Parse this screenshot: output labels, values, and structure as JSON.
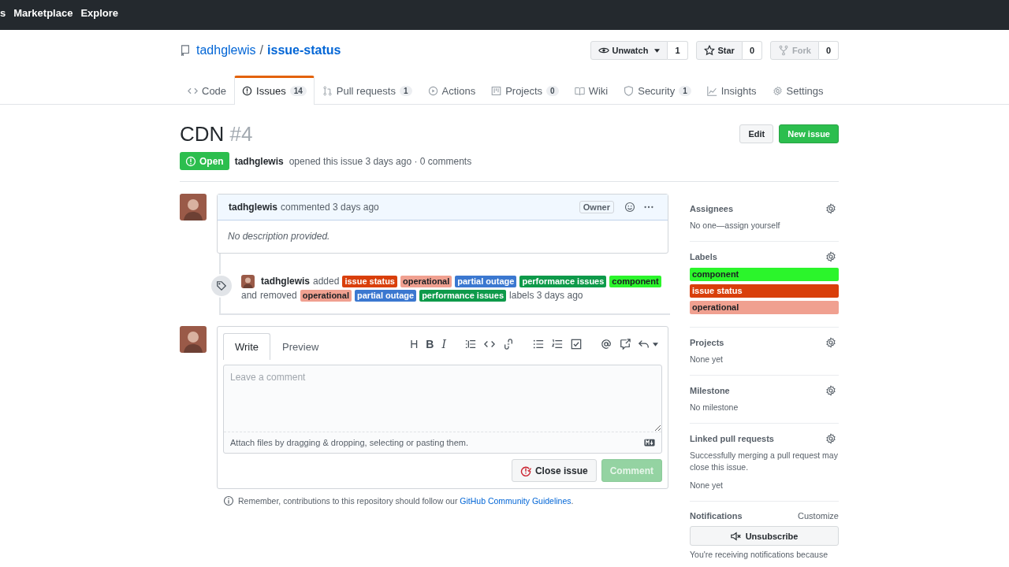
{
  "top_nav": [
    {
      "label": "s"
    },
    {
      "label": "Marketplace"
    },
    {
      "label": "Explore"
    }
  ],
  "repo": {
    "owner": "tadhglewis",
    "separator": "/",
    "name": "issue-status"
  },
  "repo_actions": [
    {
      "kind": "watch",
      "label": "Unwatch",
      "count": "1",
      "disabled": false
    },
    {
      "kind": "star",
      "label": "Star",
      "count": "0",
      "disabled": false
    },
    {
      "kind": "fork",
      "label": "Fork",
      "count": "0",
      "disabled": true
    }
  ],
  "tabs": [
    {
      "kind": "code",
      "label": "Code",
      "selected": false
    },
    {
      "kind": "issue",
      "label": "Issues",
      "count": "14",
      "selected": true
    },
    {
      "kind": "pull",
      "label": "Pull requests",
      "count": "1",
      "selected": false
    },
    {
      "kind": "play",
      "label": "Actions",
      "selected": false
    },
    {
      "kind": "board",
      "label": "Projects",
      "count": "0",
      "selected": false
    },
    {
      "kind": "book",
      "label": "Wiki",
      "selected": false
    },
    {
      "kind": "shield",
      "label": "Security",
      "count": "1",
      "selected": false
    },
    {
      "kind": "graph",
      "label": "Insights",
      "selected": false
    },
    {
      "kind": "gear",
      "label": "Settings",
      "selected": false
    }
  ],
  "issue": {
    "title": "CDN",
    "number": "#4",
    "state_label": "Open",
    "author": "tadhglewis",
    "meta": "opened this issue 3 days ago · 0 comments"
  },
  "header_buttons": [
    {
      "kind": "default",
      "label": "Edit"
    },
    {
      "kind": "primary",
      "label": "New issue"
    }
  ],
  "comment": {
    "author": "tadhglewis",
    "time": "commented 3 days ago",
    "role": "Owner",
    "body": "No description provided."
  },
  "label_event": {
    "actor": "tadhglewis",
    "added_text": "added",
    "joiner": "and",
    "removed_text": "removed",
    "suffix": "labels 3 days ago",
    "added": [
      {
        "name": "issue status",
        "color": "#d93f0b"
      },
      {
        "name": "operational",
        "color": "#f0a090"
      },
      {
        "name": "partial outage",
        "color": "#3b78d0"
      },
      {
        "name": "performance issues",
        "color": "#0e9a4a"
      },
      {
        "name": "component",
        "color": "#2bf52b"
      }
    ],
    "removed": [
      {
        "name": "operational",
        "color": "#f0a090"
      },
      {
        "name": "partial outage",
        "color": "#3b78d0"
      },
      {
        "name": "performance issues",
        "color": "#0e9a4a"
      }
    ]
  },
  "composer": {
    "tabs": [
      {
        "label": "Write",
        "selected": true
      },
      {
        "label": "Preview",
        "selected": false
      }
    ],
    "tools": [
      {
        "kind": "heading",
        "text": "H"
      },
      {
        "kind": "bold",
        "text": "B"
      },
      {
        "kind": "italic",
        "text": "I"
      },
      {
        "kind": "quote"
      },
      {
        "kind": "code"
      },
      {
        "kind": "link"
      },
      {
        "kind": "bullets"
      },
      {
        "kind": "numbers"
      },
      {
        "kind": "tasks"
      },
      {
        "kind": "mention"
      },
      {
        "kind": "reference"
      },
      {
        "kind": "reply"
      }
    ],
    "placeholder": "Leave a comment",
    "attach_hint": "Attach files by dragging & dropping, selecting or pasting them.",
    "buttons": [
      {
        "kind": "close",
        "label": "Close issue",
        "disabled": false
      },
      {
        "kind": "primary",
        "label": "Comment",
        "disabled": true
      }
    ]
  },
  "guidelines": {
    "text": "Remember, contributions to this repository should follow our",
    "link": "GitHub Community Guidelines",
    "end": "."
  },
  "sidebar": [
    {
      "kind": "text",
      "title": "Assignees",
      "lines": [
        "No one—assign yourself"
      ]
    },
    {
      "kind": "labels",
      "title": "Labels",
      "labels": [
        {
          "name": "component",
          "color": "#2bf52b"
        },
        {
          "name": "issue status",
          "color": "#d93f0b"
        },
        {
          "name": "operational",
          "color": "#f0a090"
        }
      ]
    },
    {
      "kind": "text",
      "title": "Projects",
      "lines": [
        "None yet"
      ]
    },
    {
      "kind": "text",
      "title": "Milestone",
      "lines": [
        "No milestone"
      ]
    },
    {
      "kind": "text",
      "title": "Linked pull requests",
      "lines": [
        "Successfully merging a pull request may close this issue.",
        "None yet"
      ]
    },
    {
      "kind": "notifications",
      "title": "Notifications",
      "action": "Customize",
      "button": "Unsubscribe",
      "note": "You're receiving notifications because"
    }
  ]
}
